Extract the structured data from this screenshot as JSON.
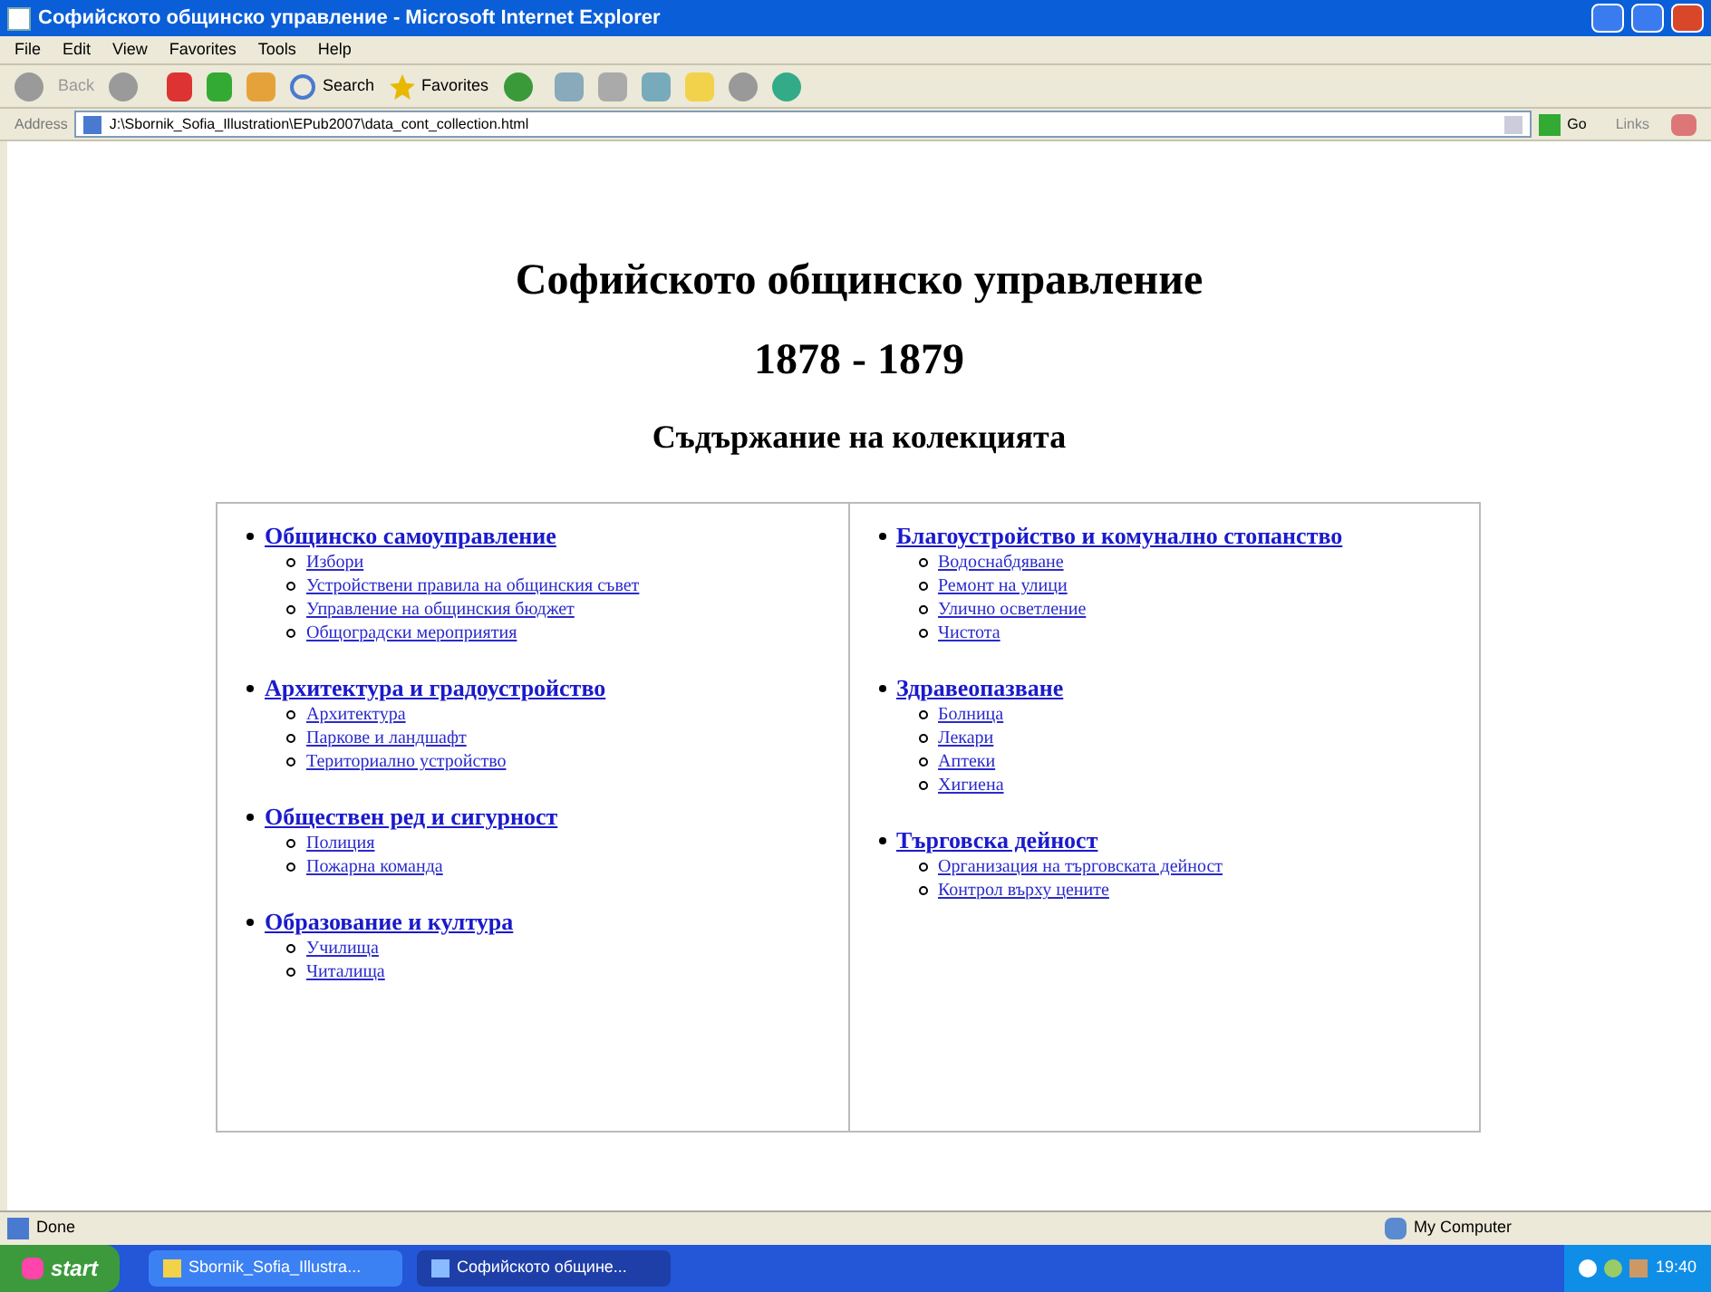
{
  "window": {
    "title": "Софийското общинско управление - Microsoft Internet Explorer"
  },
  "menu": [
    "File",
    "Edit",
    "View",
    "Favorites",
    "Tools",
    "Help"
  ],
  "toolbar": {
    "back": "Back",
    "search": "Search",
    "favorites": "Favorites"
  },
  "address_bar": {
    "label": "Address",
    "value": "J:\\Sbornik_Sofia_Illustration\\EPub2007\\data_cont_collection.html",
    "go": "Go",
    "links": "Links"
  },
  "page": {
    "title": "Софийското общинско управление",
    "years": "1878 - 1879",
    "subtitle": "Съдържание на колекцията",
    "columns": [
      {
        "sections": [
          {
            "title": "Общинско самоуправление",
            "items": [
              "Избори",
              "Устройствени правила на общинския съвет",
              "Управление на общинския бюджет",
              "Общоградски мероприятия"
            ]
          },
          {
            "title": "Архитектура и градоустройство",
            "items": [
              "Архитектура",
              "Паркове и ландшафт",
              "Териториално устройство"
            ]
          },
          {
            "title": "Обществен ред и сигурност",
            "items": [
              "Полиция",
              "Пожарна команда"
            ]
          },
          {
            "title": "Образование и култура",
            "items": [
              "Училища",
              "Читалища"
            ]
          }
        ]
      },
      {
        "sections": [
          {
            "title": "Благоустройство и комунално стопанство",
            "items": [
              "Водоснабдяване",
              "Ремонт на улици",
              "Улично осветление",
              "Чистота"
            ]
          },
          {
            "title": "Здравеопазване",
            "items": [
              "Болница",
              "Лекари",
              "Аптеки",
              "Хигиена"
            ]
          },
          {
            "title": "Търговска дейност",
            "items": [
              "Организация на търговската дейност",
              "Контрол върху цените"
            ]
          }
        ]
      }
    ]
  },
  "status_bar": {
    "status": "Done",
    "zone": "My Computer"
  },
  "taskbar": {
    "start": "start",
    "tasks": [
      {
        "label": "Sbornik_Sofia_Illustra...",
        "selected": false
      },
      {
        "label": "Софийското общине...",
        "selected": true
      }
    ],
    "clock": "19:40"
  }
}
